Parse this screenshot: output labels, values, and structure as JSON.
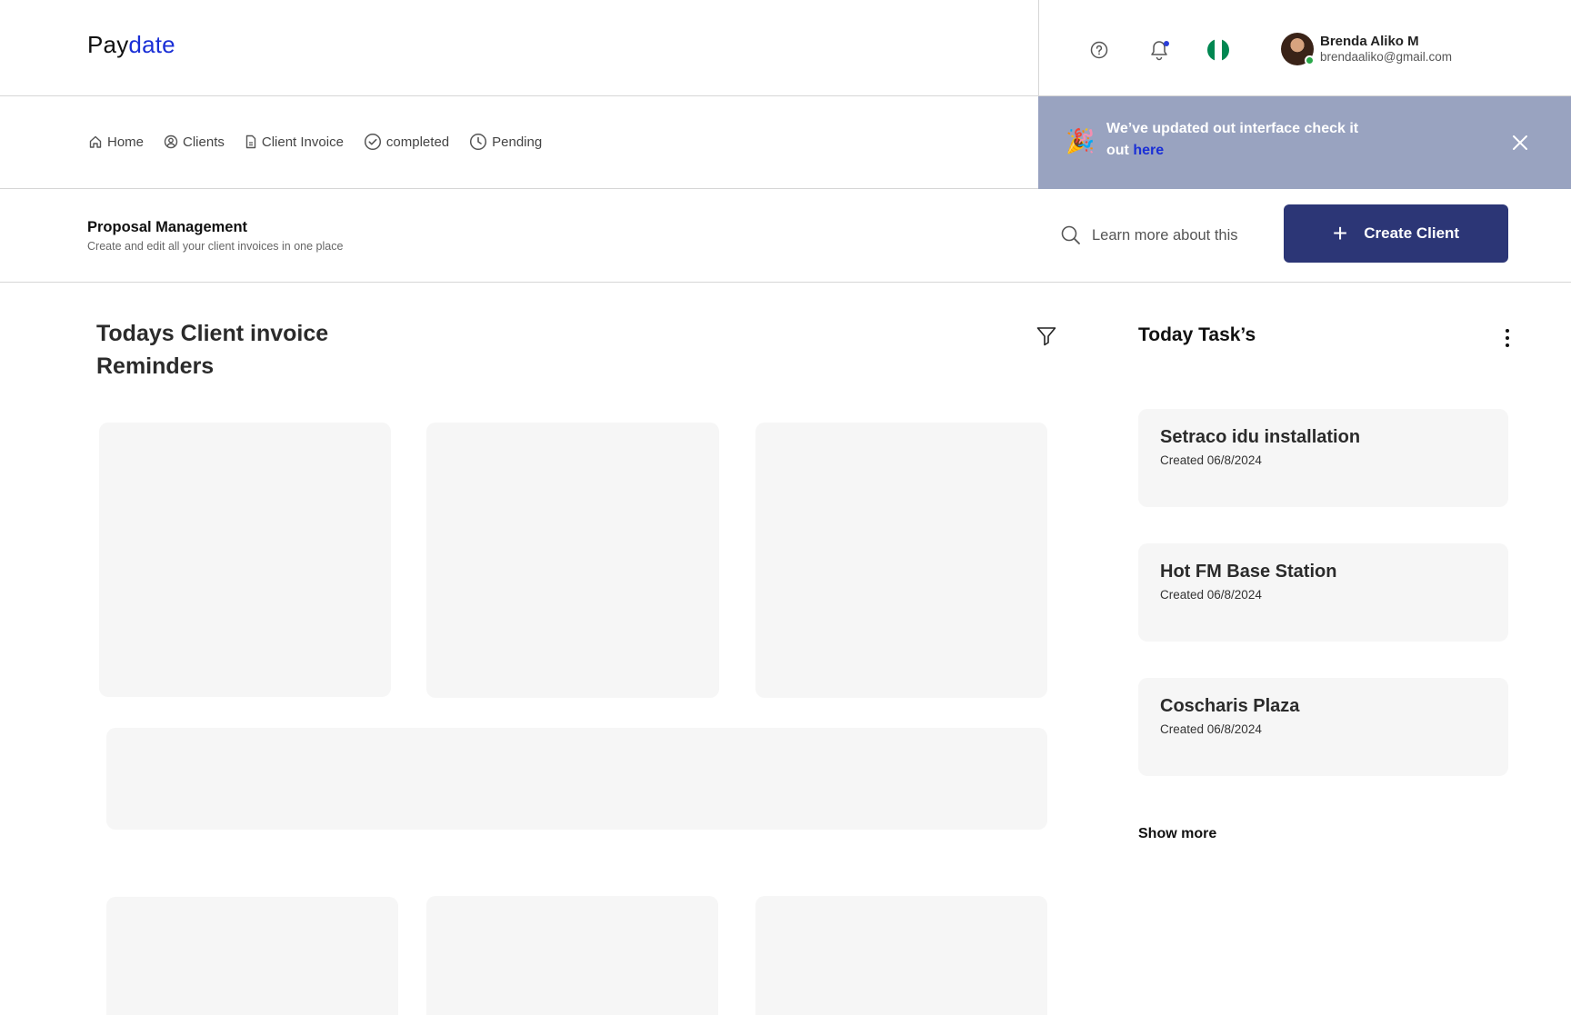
{
  "brand": {
    "logo_part1": "Pay",
    "logo_part2": "date",
    "accent_color": "#1a2fd6"
  },
  "header": {
    "icons": [
      "help-icon",
      "bell-icon",
      "nigeria-flag-icon"
    ],
    "user": {
      "name": "Brenda Aliko M",
      "email": "brendaaliko@gmail.com"
    }
  },
  "nav": {
    "items": [
      {
        "label": "Home",
        "icon": "home-icon"
      },
      {
        "label": "Clients",
        "icon": "user-circle-icon"
      },
      {
        "label": "Client Invoice",
        "icon": "document-icon"
      },
      {
        "label": "completed",
        "icon": "check-circle-icon"
      },
      {
        "label": "Pending",
        "icon": "clock-icon"
      }
    ]
  },
  "banner": {
    "emoji": "🎉",
    "text": "We’ve updated out interface check it out ",
    "link": "here",
    "background": "#99a3c0"
  },
  "page_header": {
    "title": "Proposal Management",
    "subtitle": "Create and edit all your client invoices in one place",
    "learn_more": "Learn more about this",
    "create_button": "Create Client",
    "button_color": "#2c3676"
  },
  "reminders": {
    "title": "Todays Client invoice Reminders"
  },
  "tasks": {
    "title": "Today Task’s",
    "items": [
      {
        "name": "Setraco idu installation",
        "created": "Created 06/8/2024"
      },
      {
        "name": "Hot FM Base Station",
        "created": "Created 06/8/2024"
      },
      {
        "name": "Coscharis Plaza",
        "created": "Created 06/8/2024"
      }
    ],
    "show_more": "Show more"
  }
}
